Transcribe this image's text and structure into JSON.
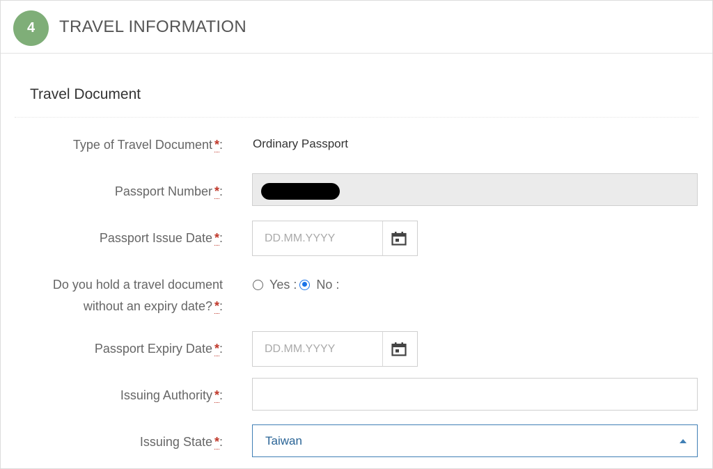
{
  "step": {
    "number": "4",
    "title": "TRAVEL INFORMATION",
    "badge_color": "#7fae78"
  },
  "section": {
    "title": "Travel Document"
  },
  "fields": {
    "doc_type": {
      "label": "Type of Travel Document",
      "value": "Ordinary Passport"
    },
    "passport_number": {
      "label": "Passport Number",
      "value": ""
    },
    "issue_date": {
      "label": "Passport Issue Date",
      "placeholder": "DD.MM.YYYY"
    },
    "no_expiry": {
      "label_line1": "Do you hold a travel document",
      "label_line2": "without an expiry date?",
      "options": [
        {
          "label": "Yes :",
          "checked": false
        },
        {
          "label": "No :",
          "checked": true
        }
      ]
    },
    "expiry_date": {
      "label": "Passport Expiry Date",
      "placeholder": "DD.MM.YYYY"
    },
    "issuing_authority": {
      "label": "Issuing Authority",
      "value": ""
    },
    "issuing_state": {
      "label": "Issuing State",
      "value": "Taiwan"
    }
  },
  "required_marker": "*",
  "colon": ":",
  "icons": {
    "calendar": "calendar-icon",
    "dropdown": "caret-up-icon"
  },
  "colors": {
    "accent": "#1a73e8",
    "required": "#c0392b",
    "select_text": "#2a6496"
  }
}
